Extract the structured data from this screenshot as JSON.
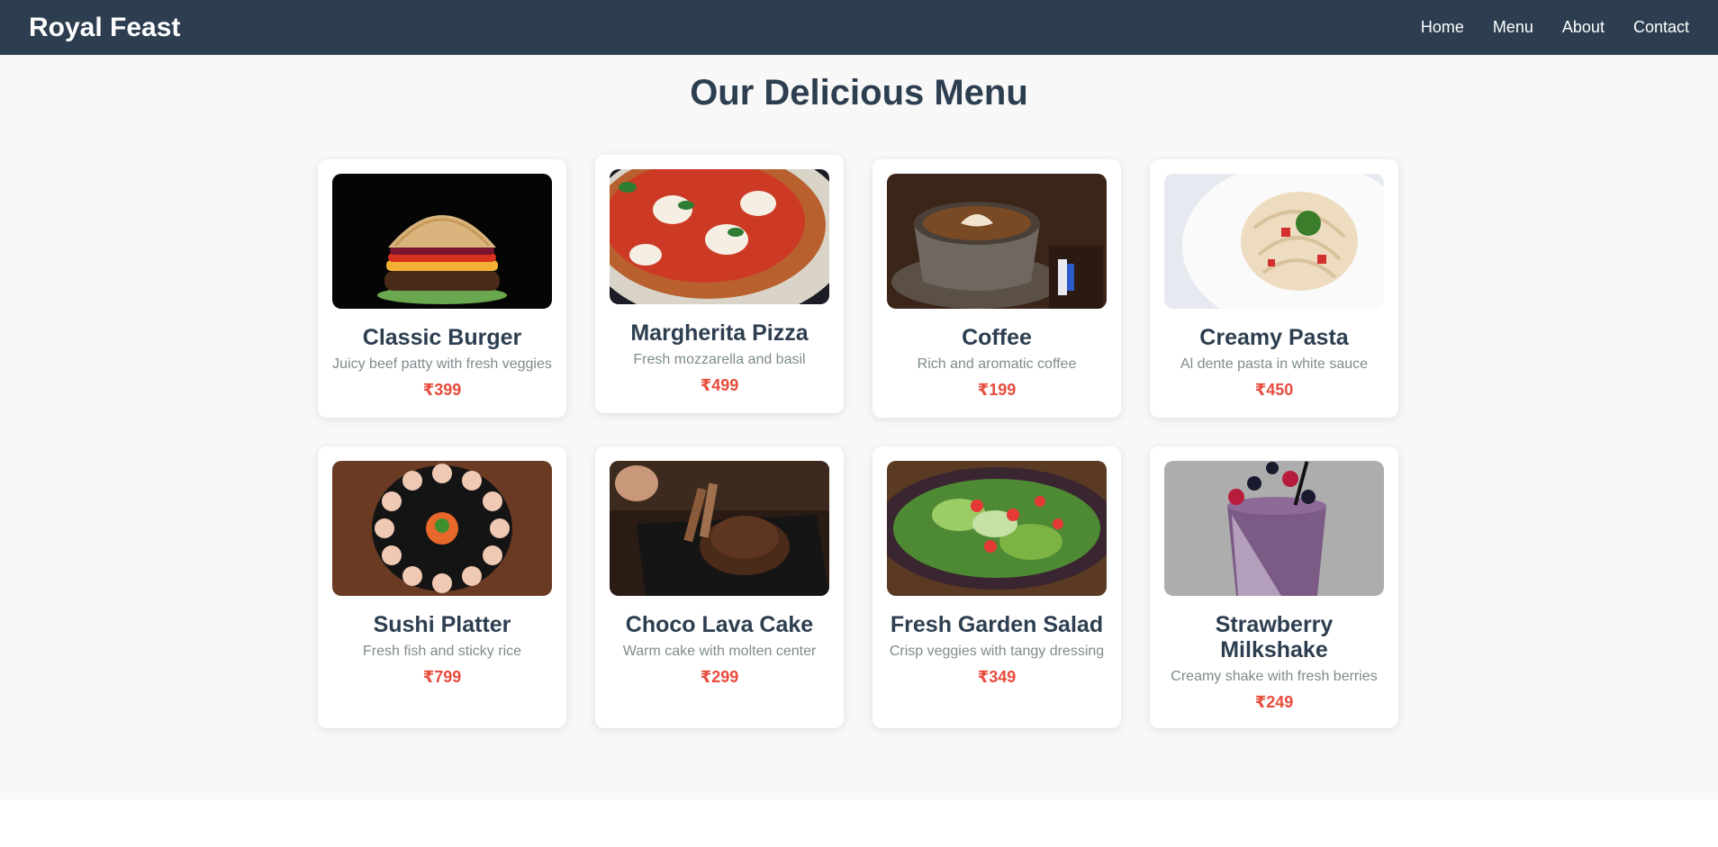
{
  "brand": "Royal Feast",
  "nav": [
    "Home",
    "Menu",
    "About",
    "Contact"
  ],
  "page_title": "Our Delicious Menu",
  "menu": [
    {
      "name": "Classic Burger",
      "desc": "Juicy beef patty with fresh veggies",
      "price": "₹399"
    },
    {
      "name": "Margherita Pizza",
      "desc": "Fresh mozzarella and basil",
      "price": "₹499"
    },
    {
      "name": "Coffee",
      "desc": "Rich and aromatic coffee",
      "price": "₹199"
    },
    {
      "name": "Creamy Pasta",
      "desc": "Al dente pasta in white sauce",
      "price": "₹450"
    },
    {
      "name": "Sushi Platter",
      "desc": "Fresh fish and sticky rice",
      "price": "₹799"
    },
    {
      "name": "Choco Lava Cake",
      "desc": "Warm cake with molten center",
      "price": "₹299"
    },
    {
      "name": "Fresh Garden Salad",
      "desc": "Crisp veggies with tangy dressing",
      "price": "₹349"
    },
    {
      "name": "Strawberry Milkshake",
      "desc": "Creamy shake with fresh berries",
      "price": "₹249"
    }
  ]
}
